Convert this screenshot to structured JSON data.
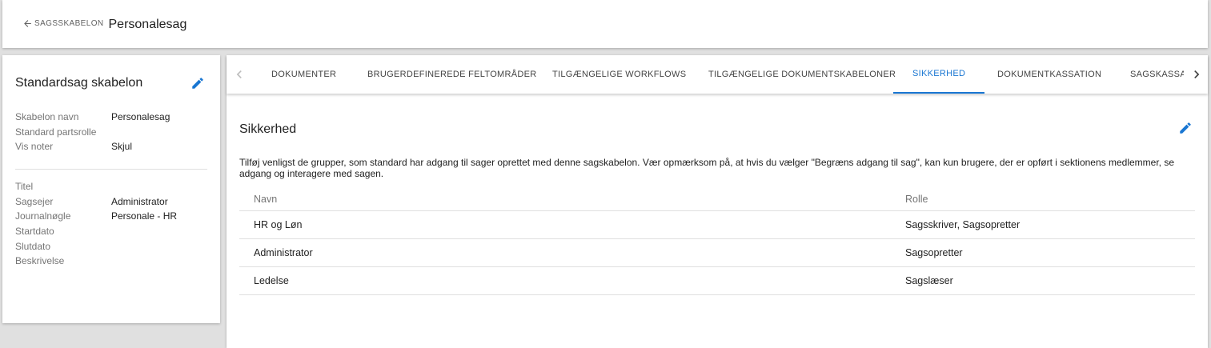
{
  "header": {
    "back_label": "SAGSSKABELON",
    "title": "Personalesag"
  },
  "left_panel": {
    "title": "Standardsag skabelon",
    "group1": [
      {
        "label": "Skabelon navn",
        "value": "Personalesag"
      },
      {
        "label": "Standard partsrolle",
        "value": ""
      },
      {
        "label": "Vis noter",
        "value": "Skjul"
      }
    ],
    "group2": [
      {
        "label": "Titel",
        "value": ""
      },
      {
        "label": "Sagsejer",
        "value": "Administrator"
      },
      {
        "label": "Journalnøgle",
        "value": "Personale - HR"
      },
      {
        "label": "Startdato",
        "value": ""
      },
      {
        "label": "Slutdato",
        "value": ""
      },
      {
        "label": "Beskrivelse",
        "value": ""
      }
    ]
  },
  "tabs": [
    {
      "label": "DOKUMENTER"
    },
    {
      "label": "BRUGERDEFINEREDE FELTOMRÅDER"
    },
    {
      "label": "TILGÆNGELIGE WORKFLOWS"
    },
    {
      "label": "TILGÆNGELIGE DOKUMENTSKABELONER"
    },
    {
      "label": "SIKKERHED"
    },
    {
      "label": "DOKUMENTKASSATION"
    },
    {
      "label": "SAGSKASSATION"
    }
  ],
  "active_tab": "SIKKERHED",
  "security": {
    "title": "Sikkerhed",
    "description": "Tilføj venligst de grupper, som standard har adgang til sager oprettet med denne sagskabelon. Vær opmærksom på, at hvis du vælger \"Begræns adgang til sag\", kan kun brugere, der er opført i sektionens medlemmer, se adgang og interagere med sagen.",
    "columns": {
      "name": "Navn",
      "role": "Rolle"
    },
    "rows": [
      {
        "name": "HR og Løn",
        "role": "Sagsskriver, Sagsopretter"
      },
      {
        "name": "Administrator",
        "role": "Sagsopretter"
      },
      {
        "name": "Ledelse",
        "role": "Sagslæser"
      }
    ]
  },
  "colors": {
    "accent": "#1976d2",
    "background": "#e0e0e0",
    "card": "#ffffff"
  },
  "icons": {
    "back": "arrow-left-icon",
    "edit": "pencil-icon",
    "prev": "chevron-left-icon",
    "next": "chevron-right-icon"
  }
}
